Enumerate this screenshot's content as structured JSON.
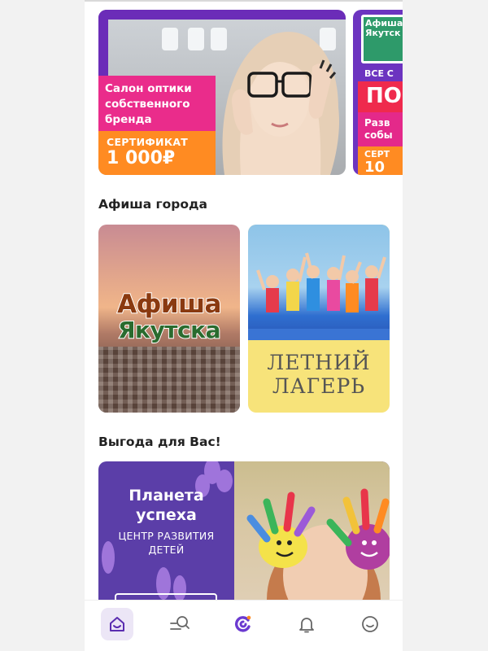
{
  "carousel": {
    "banners": [
      {
        "title_lines": [
          "Салон оптики",
          "собственного",
          "бренда"
        ],
        "cert_label": "СЕРТИФИКАТ",
        "cert_value": "1 000₽"
      },
      {
        "head_lines": [
          "Афиша",
          "Якутск"
        ],
        "line1": "ВСЕ С",
        "big": "ПО",
        "pink_lines": [
          "Разв",
          "собы"
        ],
        "orange_label": "СЕРТ",
        "orange_value": "10"
      }
    ]
  },
  "sections": {
    "afisha_title": "Афиша города",
    "benefit_title": "Выгода для Вас!"
  },
  "afisha_cards": [
    {
      "line1": "Афиша",
      "line2": "Якутска"
    },
    {
      "line1": "ЛЕТНИЙ",
      "line2": "ЛАГЕРЬ"
    }
  ],
  "benefit_card": {
    "title_lines": [
      "Планета",
      "успеха"
    ],
    "subtitle_lines": [
      "ЦЕНТР РАЗВИТИЯ",
      "ДЕТЕЙ"
    ]
  },
  "bottom_nav": {
    "items": [
      {
        "icon": "home-icon",
        "active": true
      },
      {
        "icon": "search-list-icon",
        "active": false
      },
      {
        "icon": "brand-logo-icon",
        "active": false
      },
      {
        "icon": "bell-icon",
        "active": false
      },
      {
        "icon": "smile-profile-icon",
        "active": false
      }
    ]
  },
  "colors": {
    "accent": "#6b2cb8",
    "pink": "#ea2c8b",
    "orange": "#ff8b22",
    "nav_active_bg": "#ece6f6"
  }
}
